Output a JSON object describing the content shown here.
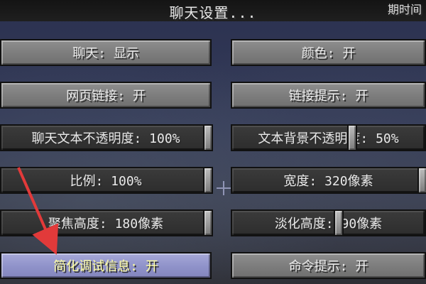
{
  "header": {
    "title": "聊天设置...",
    "top_right": "期时间"
  },
  "left_column": [
    {
      "id": "chat",
      "label": "聊天: 显示"
    },
    {
      "id": "web_links",
      "label": "网页链接: 开"
    },
    {
      "id": "chat_opacity",
      "label": "聊天文本不透明度: 100%",
      "slider_value": 1.0
    },
    {
      "id": "scale",
      "label": "比例: 100%",
      "slider_value": 1.0
    },
    {
      "id": "focused_height",
      "label": "聚焦高度: 180像素",
      "slider_value": 1.0
    },
    {
      "id": "reduced_debug",
      "label": "简化调试信息: 开",
      "highlighted": true
    }
  ],
  "right_column": [
    {
      "id": "colors",
      "label": "颜色: 开"
    },
    {
      "id": "link_prompt",
      "label": "链接提示: 开"
    },
    {
      "id": "text_bg_opacity",
      "label": "文本背景不透明度: 50%",
      "slider_value": 0.5
    },
    {
      "id": "width",
      "label": "宽度: 320像素",
      "slider_value": 1.0
    },
    {
      "id": "fade",
      "label": "淡化高度: 90像素",
      "slider_value": 0.5
    },
    {
      "id": "command_suggest",
      "label": "命令提示: 开"
    }
  ],
  "colors": {
    "text": "#e9e9e9",
    "highlight_text": "#ffffa0",
    "arrow": "#e23a3a"
  }
}
